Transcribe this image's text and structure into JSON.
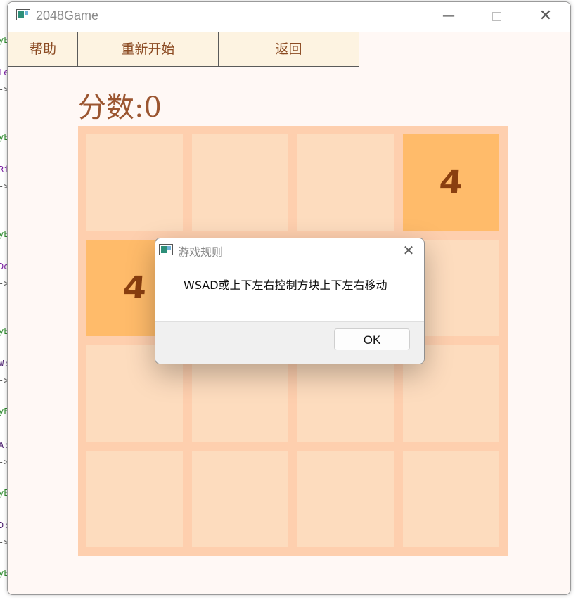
{
  "background_code_fragments": [
    {
      "text": "yE",
      "color": "#2e8b2e"
    },
    {
      "text": "Le",
      "color": "#7a1fa2"
    },
    {
      "text": "->",
      "color": "#555555"
    },
    {
      "text": "yE",
      "color": "#2e8b2e"
    },
    {
      "text": "Ri",
      "color": "#7a1fa2"
    },
    {
      "text": "->",
      "color": "#555555"
    },
    {
      "text": "yE",
      "color": "#2e8b2e"
    },
    {
      "text": "Do",
      "color": "#7a1fa2"
    },
    {
      "text": "->",
      "color": "#555555"
    },
    {
      "text": "yE",
      "color": "#2e8b2e"
    },
    {
      "text": "W:",
      "color": "#4b1d6e"
    },
    {
      "text": "->",
      "color": "#555555"
    },
    {
      "text": "yE",
      "color": "#2e8b2e"
    },
    {
      "text": "A:",
      "color": "#4b1d6e"
    },
    {
      "text": "->",
      "color": "#555555"
    },
    {
      "text": "yE",
      "color": "#2e8b2e"
    },
    {
      "text": "D:",
      "color": "#4b1d6e"
    },
    {
      "text": "->",
      "color": "#555555"
    },
    {
      "text": "yE",
      "color": "#2e8b2e"
    }
  ],
  "window": {
    "title": "2048Game",
    "minimize_glyph": "—",
    "close_glyph": "✕"
  },
  "toolbar": {
    "help_label": "帮助",
    "restart_label": "重新开始",
    "back_label": "返回"
  },
  "score": {
    "text": "分数:0",
    "value": 0
  },
  "board": {
    "size": 4,
    "cells": [
      [
        null,
        null,
        null,
        "4"
      ],
      [
        "4",
        null,
        null,
        null
      ],
      [
        null,
        null,
        null,
        null
      ],
      [
        null,
        null,
        null,
        null
      ]
    ],
    "colors": {
      "board_bg": "#fecfae",
      "empty_cell": "#fddcbe",
      "tile_4": "#ffbb6a",
      "number": "#8a3f10"
    }
  },
  "dialog": {
    "title": "游戏规则",
    "message": "WSAD或上下左右控制方块上下左右移动",
    "ok_label": "OK",
    "close_glyph": "✕"
  }
}
